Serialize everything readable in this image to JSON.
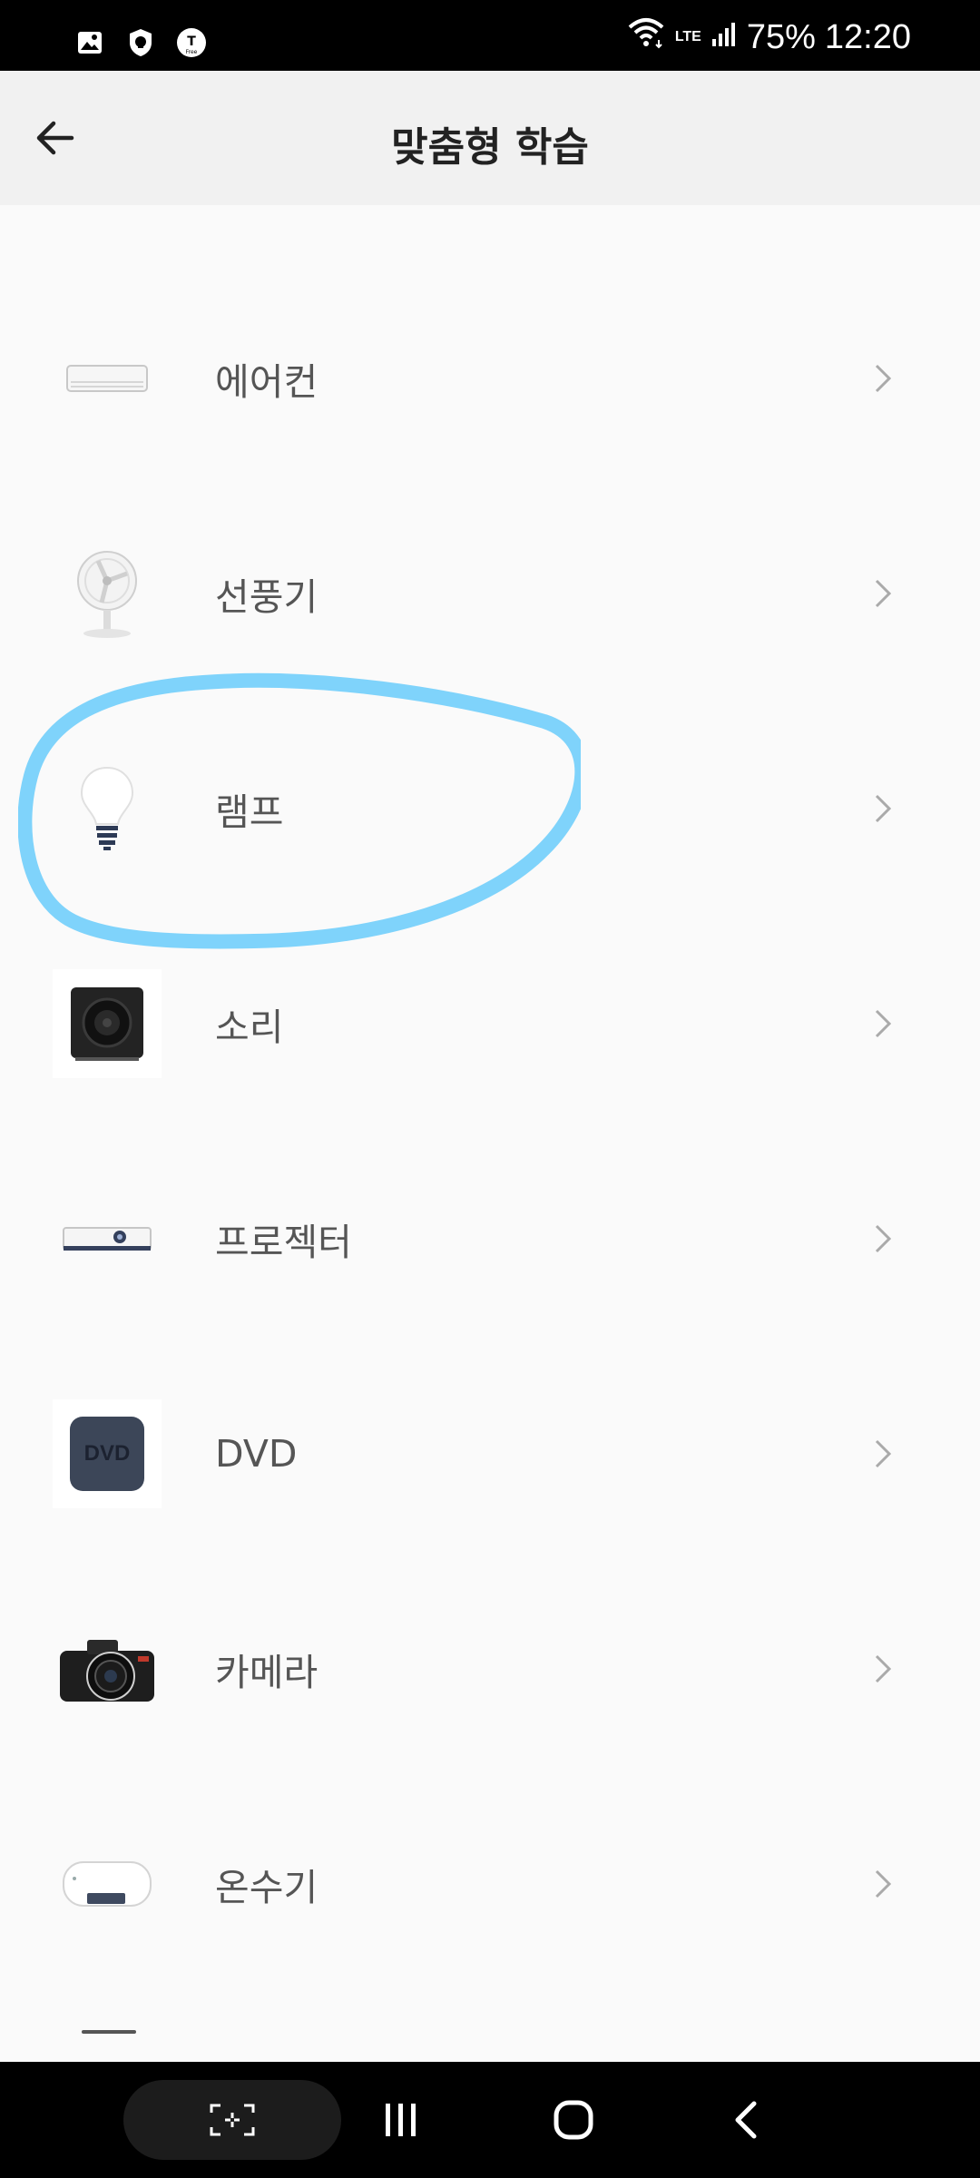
{
  "status_bar": {
    "network": "LTE",
    "battery": "75%",
    "time": "12:20",
    "icons": [
      "image-icon",
      "shield-icon",
      "t-free-icon",
      "wifi-icon",
      "signal-icon"
    ]
  },
  "header": {
    "title": "맞춤형 학습",
    "back_icon": "arrow-left-icon"
  },
  "devices": [
    {
      "label": "에어컨",
      "icon": "air-conditioner-icon"
    },
    {
      "label": "선풍기",
      "icon": "fan-icon"
    },
    {
      "label": "램프",
      "icon": "lamp-icon"
    },
    {
      "label": "소리",
      "icon": "speaker-icon"
    },
    {
      "label": "프로젝터",
      "icon": "projector-icon"
    },
    {
      "label": "DVD",
      "icon": "dvd-icon",
      "icon_text": "DVD"
    },
    {
      "label": "카메라",
      "icon": "camera-icon"
    },
    {
      "label": "온수기",
      "icon": "water-heater-icon"
    }
  ],
  "colors": {
    "annotation": "#7fd3fb",
    "header_bg": "#f1f1f1",
    "page_bg": "#fafafa",
    "label": "#555555"
  },
  "nav_bar": {
    "icons": [
      "screenshot-capture-icon",
      "recent-apps-icon",
      "home-icon",
      "back-icon"
    ]
  }
}
